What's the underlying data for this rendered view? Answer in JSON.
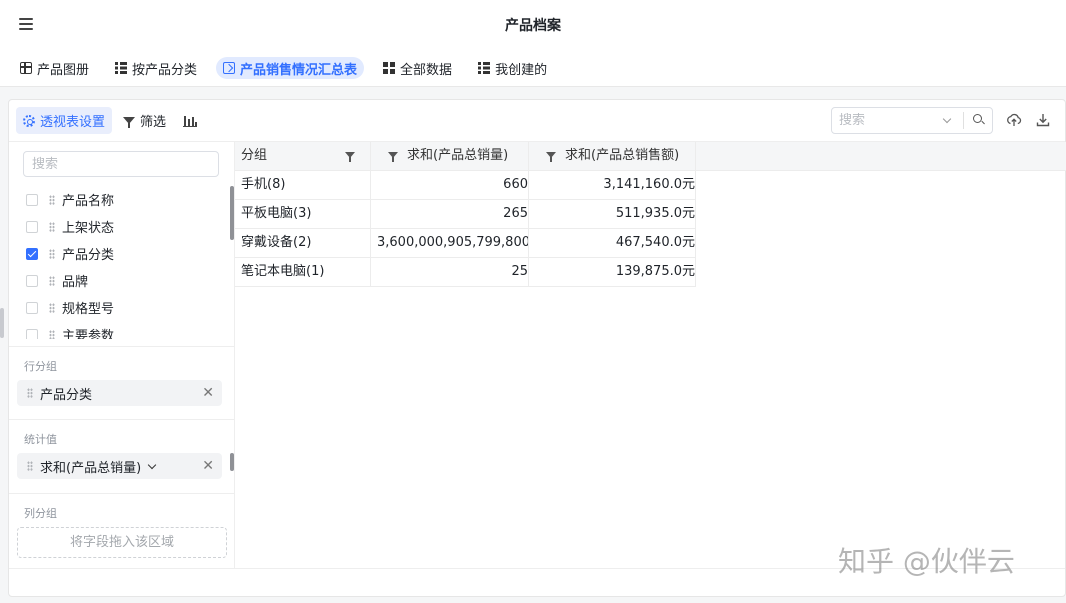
{
  "app": {
    "title": "产品档案"
  },
  "tabs": [
    {
      "label": "产品图册",
      "icon": "grid-icon",
      "active": false
    },
    {
      "label": "按产品分类",
      "icon": "table-icon",
      "active": false
    },
    {
      "label": "产品销售情况汇总表",
      "icon": "pivot-icon",
      "active": true
    },
    {
      "label": "全部数据",
      "icon": "quad-icon",
      "active": false
    },
    {
      "label": "我创建的",
      "icon": "table-icon",
      "active": false
    }
  ],
  "toolbar": {
    "pivot_settings_label": "透视表设置",
    "filter_label": "筛选",
    "search_placeholder": "搜索"
  },
  "left_panel": {
    "search_placeholder": "搜索",
    "fields": [
      {
        "label": "产品名称",
        "checked": false
      },
      {
        "label": "上架状态",
        "checked": false
      },
      {
        "label": "产品分类",
        "checked": true
      },
      {
        "label": "品牌",
        "checked": false
      },
      {
        "label": "规格型号",
        "checked": false
      },
      {
        "label": "主要参数",
        "checked": false
      }
    ],
    "row_group": {
      "label": "行分组",
      "chips": [
        "产品分类"
      ]
    },
    "values": {
      "label": "统计值",
      "chips": [
        "求和(产品总销量)"
      ]
    },
    "column_group": {
      "label": "列分组",
      "dropzone": "将字段拖入该区域"
    }
  },
  "table": {
    "headers": [
      "分组",
      "求和(产品总销量)",
      "求和(产品总销售额)"
    ],
    "rows": [
      [
        "手机(8)",
        "660",
        "3,141,160.0元"
      ],
      [
        "平板电脑(3)",
        "265",
        "511,935.0元"
      ],
      [
        "穿戴设备(2)",
        "3,600,000,905,799,800",
        "467,540.0元"
      ],
      [
        "笔记本电脑(1)",
        "25",
        "139,875.0元"
      ]
    ]
  },
  "watermark": "知乎 @伙伴云"
}
